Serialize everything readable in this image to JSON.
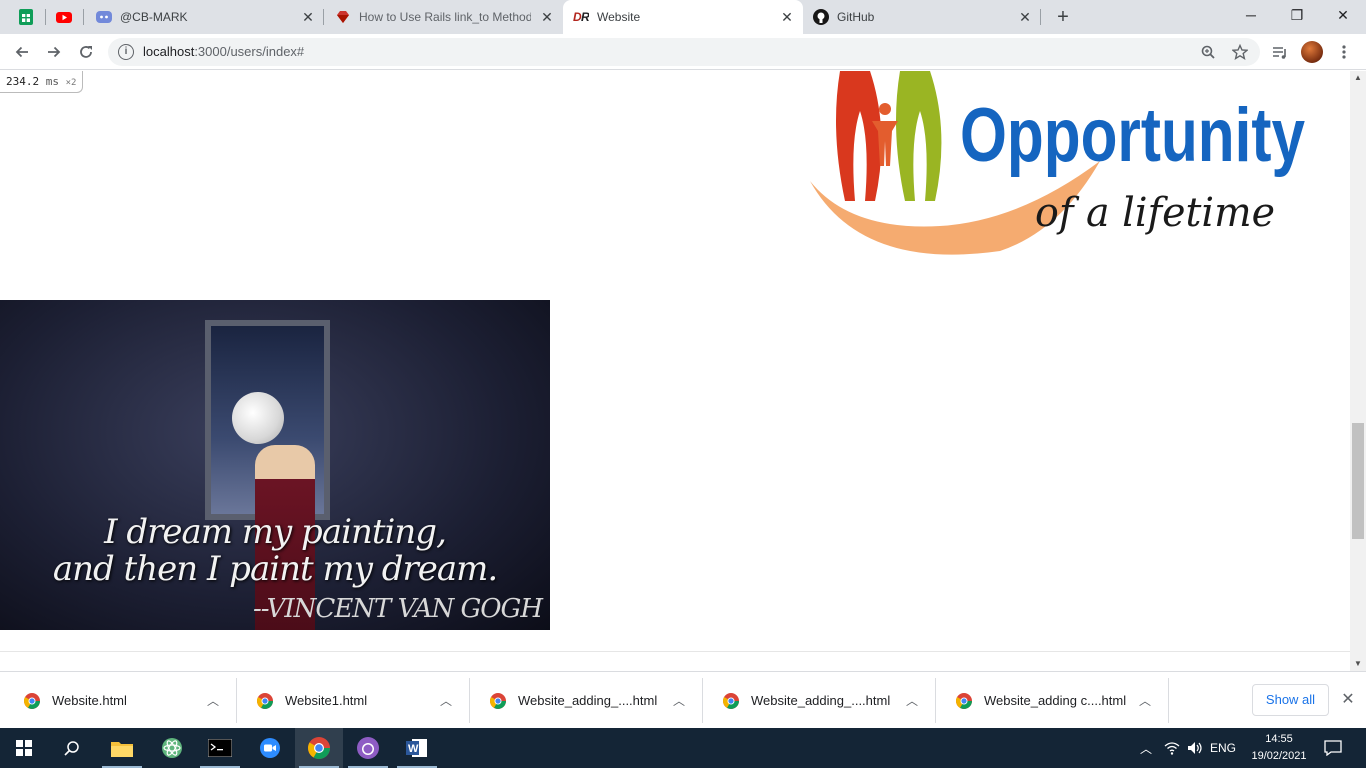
{
  "browser": {
    "tabs": [
      {
        "title": "",
        "icon": "google-sheets-icon"
      },
      {
        "title": "",
        "icon": "youtube-icon"
      },
      {
        "title": "@CB-MARK",
        "icon": "discord-icon"
      },
      {
        "title": "How to Use Rails link_to Method",
        "icon": "ruby-icon"
      },
      {
        "title": "Website",
        "icon": "dr-icon"
      },
      {
        "title": "GitHub",
        "icon": "github-icon"
      }
    ],
    "new_tab": "+",
    "url_host": "localhost",
    "url_path": ":3000/users/index#"
  },
  "page": {
    "perf_value": "234.2",
    "perf_unit": "ms",
    "perf_mult": "×2",
    "logo_word": "Opportunity",
    "logo_tagline": "of a lifetime",
    "quote_line1": "I dream my painting,",
    "quote_line2": "and then I paint my dream.",
    "quote_author": "--VINCENT VAN GOGH"
  },
  "downloads": {
    "items": [
      {
        "name": "Website.html"
      },
      {
        "name": "Website1.html"
      },
      {
        "name": "Website_adding_....html"
      },
      {
        "name": "Website_adding_....html"
      },
      {
        "name": "Website_adding c....html"
      }
    ],
    "show_all": "Show all"
  },
  "taskbar": {
    "lang": "ENG",
    "time": "14:55",
    "date": "19/02/2021"
  },
  "colors": {
    "accent": "#1a73e8",
    "taskbar_bg": "#142536",
    "logo_blue": "#1565c0",
    "logo_orange": "#f4a261",
    "logo_red": "#d9381e",
    "logo_green": "#9ab523"
  }
}
